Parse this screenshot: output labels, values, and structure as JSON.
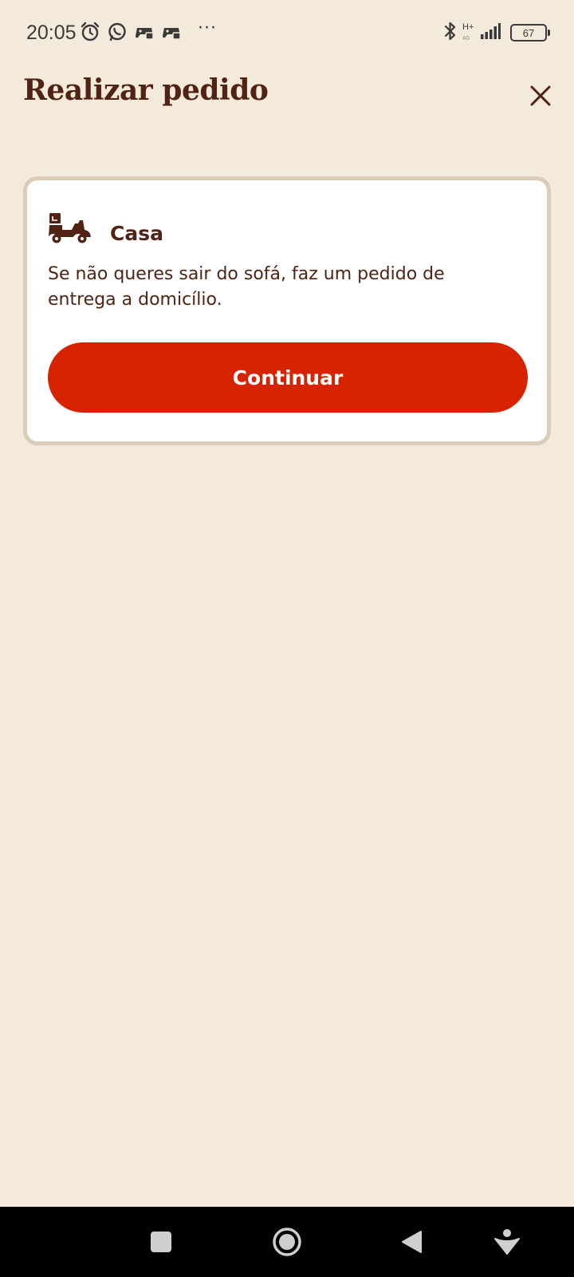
{
  "status_bar": {
    "time": "20:05",
    "network_type": "H+",
    "network_sub": "4G",
    "battery": "67",
    "icons": [
      "alarm-icon",
      "whatsapp-icon",
      "game-controller-icon",
      "game-controller-icon",
      "more-notifications-icon",
      "bluetooth-icon",
      "signal-icon",
      "battery-icon"
    ]
  },
  "header": {
    "title": "Realizar pedido",
    "close_icon": "close-icon"
  },
  "card": {
    "icon": "delivery-scooter-icon",
    "title": "Casa",
    "description": "Se não queres sair do sofá, faz um pedido de entrega a domicílio.",
    "button_label": "Continuar"
  },
  "nav_bar": {
    "buttons": [
      "recents-square-icon",
      "home-circle-icon",
      "back-triangle-icon",
      "assistant-icon"
    ]
  },
  "colors": {
    "background": "#f4eadc",
    "text_brown": "#502314",
    "button_red": "#d62300",
    "card_border": "#dccbb7",
    "card_background": "#ffffff"
  }
}
